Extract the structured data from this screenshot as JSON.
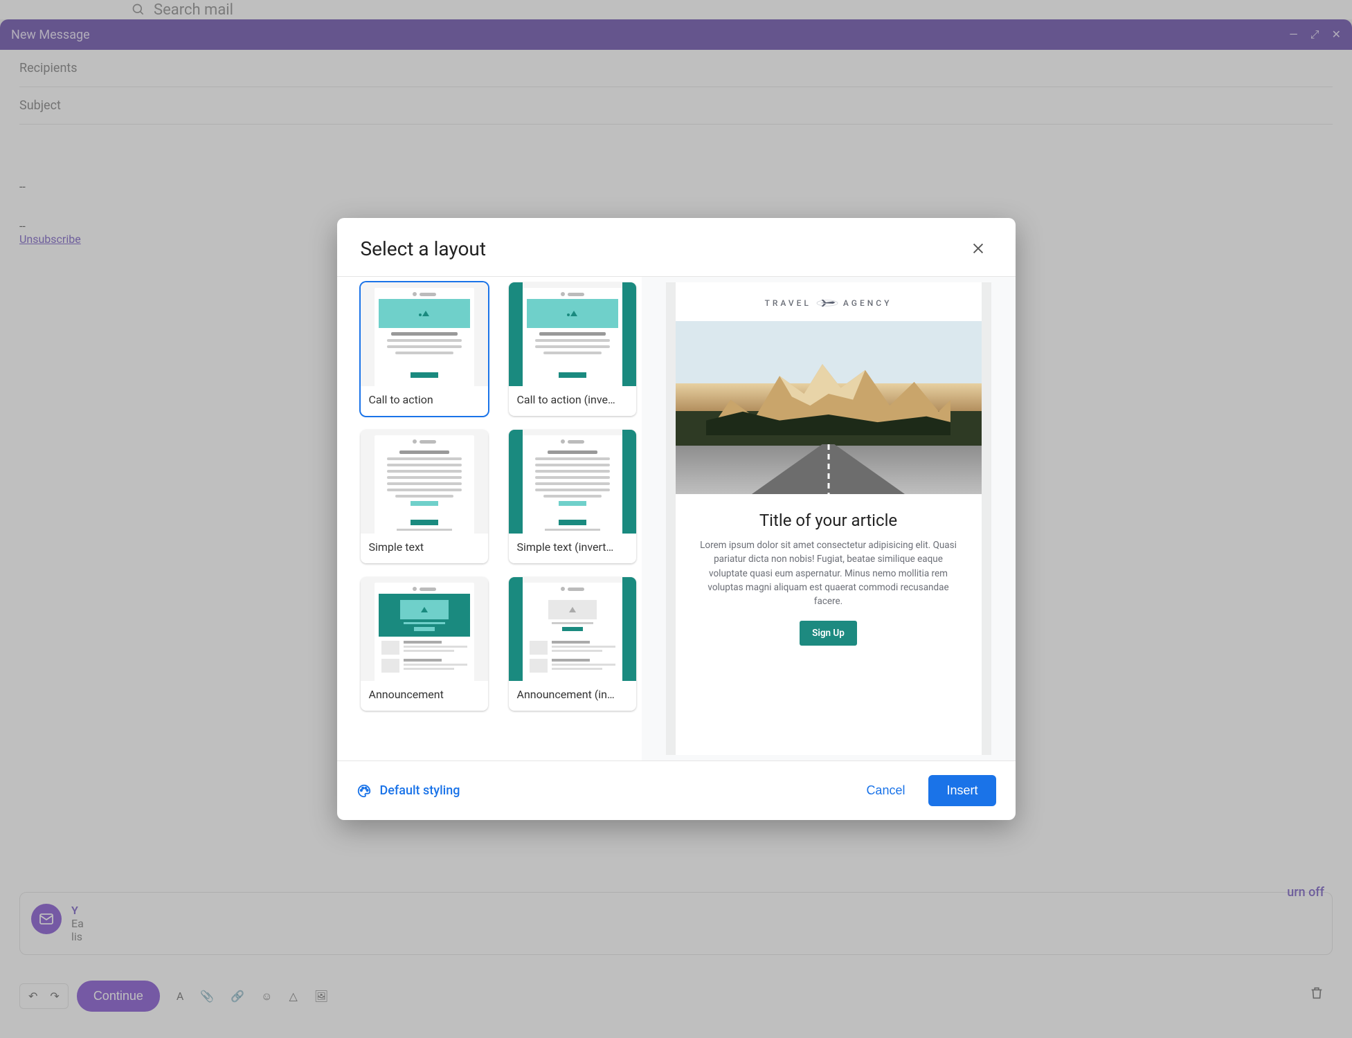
{
  "compose": {
    "search_placeholder": "Search mail",
    "title": "New Message",
    "recipients_label": "Recipients",
    "subject_label": "Subject",
    "divider": "--",
    "unsubscribe": "Unsubscribe",
    "mailmerge_title_fragment": "Y",
    "mailmerge_line1": "Ea",
    "mailmerge_line2": "lis",
    "turn_off": "urn off",
    "continue": "Continue"
  },
  "modal": {
    "title": "Select a layout",
    "layouts": [
      {
        "id": "cta",
        "label": "Call to action",
        "selected": true
      },
      {
        "id": "cta-inv",
        "label": "Call to action (inve…",
        "selected": false
      },
      {
        "id": "simple",
        "label": "Simple text",
        "selected": false
      },
      {
        "id": "simple-inv",
        "label": "Simple text (invert…",
        "selected": false
      },
      {
        "id": "announcement",
        "label": "Announcement",
        "selected": false
      },
      {
        "id": "announcement-inv",
        "label": "Announcement (in…",
        "selected": false
      }
    ],
    "preview": {
      "logo_left": "TRAVEL",
      "logo_right": "AGENCY",
      "article_title": "Title of your article",
      "body": "Lorem ipsum dolor sit amet consectetur adipisicing elit. Quasi pariatur dicta non nobis! Fugiat, beatae similique eaque voluptate quasi eum aspernatur. Minus nemo mollitia rem voluptas magni aliquam est quaerat commodi recusandae facere.",
      "cta": "Sign Up"
    },
    "footer": {
      "styling": "Default styling",
      "cancel": "Cancel",
      "insert": "Insert"
    }
  }
}
